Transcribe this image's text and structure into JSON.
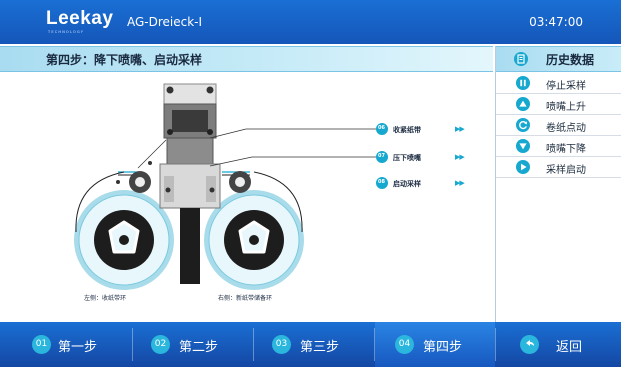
{
  "header": {
    "logo": "Leekay",
    "logo_sub": "TECHNOLOGY",
    "app_title": "AG-Dreieck-I",
    "time": "03:47:00"
  },
  "step_banner": {
    "title": "第四步：降下喷嘴、启动采样"
  },
  "sidebar": {
    "history_label": "历史数据",
    "items": [
      {
        "label": "停止采样",
        "icon": "pause-icon"
      },
      {
        "label": "喷嘴上升",
        "icon": "triangle-up-icon"
      },
      {
        "label": "卷纸点动",
        "icon": "refresh-icon"
      },
      {
        "label": "喷嘴下降",
        "icon": "triangle-down-icon"
      },
      {
        "label": "采样启动",
        "icon": "play-icon"
      }
    ]
  },
  "diagram": {
    "callouts": [
      {
        "num": "06",
        "label": "收紧纸带",
        "arrows": "▶▶"
      },
      {
        "num": "07",
        "label": "压下喷嘴",
        "arrows": "▶▶"
      },
      {
        "num": "08",
        "label": "启动采样",
        "arrows": "▶▶"
      }
    ],
    "left_caption": "左侧：收纸带环",
    "right_caption": "右侧：新纸带储备环"
  },
  "nav": {
    "steps": [
      {
        "num": "01",
        "label": "第一步"
      },
      {
        "num": "02",
        "label": "第二步"
      },
      {
        "num": "03",
        "label": "第三步"
      },
      {
        "num": "04",
        "label": "第四步"
      }
    ],
    "back_label": "返回"
  },
  "colors": {
    "header_blue": "#1a6fd4",
    "accent_cyan": "#16a8cf",
    "banner_light": "#c9ecf8"
  }
}
